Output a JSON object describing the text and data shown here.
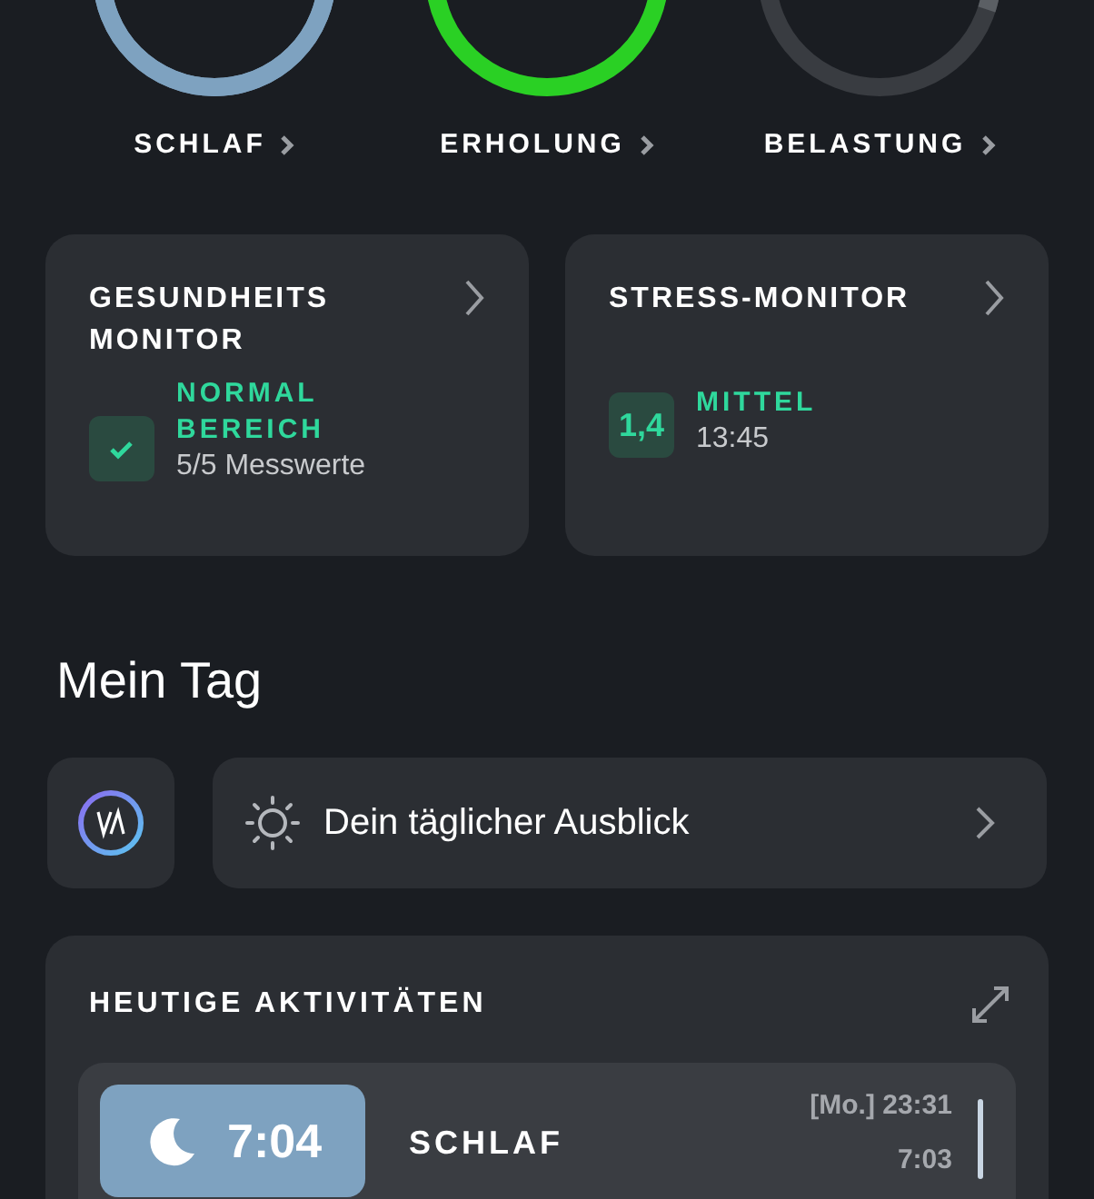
{
  "rings": [
    {
      "kind": "sleep",
      "label": "SCHLAF"
    },
    {
      "kind": "recovery",
      "label": "ERHOLUNG"
    },
    {
      "kind": "strain",
      "label": "BELASTUNG"
    }
  ],
  "monitors": [
    {
      "kind": "check",
      "title": "GESUNDHEITS MONITOR",
      "status": "NORMAL BEREICH",
      "detail": "5/5 Messwerte"
    },
    {
      "kind": "value",
      "title": "STRESS-MONITOR",
      "badge": "1,4",
      "status": "MITTEL",
      "detail": "13:45"
    }
  ],
  "my_day": {
    "heading": "Mein Tag",
    "outlook": "Dein täglicher Ausblick"
  },
  "activities": {
    "heading": "HEUTIGE AKTIVITÄTEN",
    "items": [
      {
        "duration": "7:04",
        "name": "SCHLAF",
        "start": "[Mo.] 23:31",
        "end": "7:03"
      }
    ]
  }
}
